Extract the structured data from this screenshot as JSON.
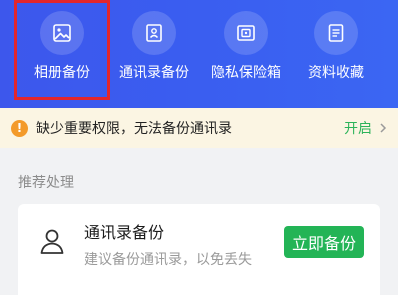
{
  "tools": {
    "items": [
      {
        "label": "相册备份",
        "icon": "photo-album-icon",
        "selected": true
      },
      {
        "label": "通讯录备份",
        "icon": "contacts-icon",
        "selected": false
      },
      {
        "label": "隐私保险箱",
        "icon": "safe-icon",
        "selected": false
      },
      {
        "label": "资料收藏",
        "icon": "document-icon",
        "selected": false
      }
    ]
  },
  "notice": {
    "text": "缺少重要权限，无法备份通讯录",
    "action": "开启",
    "icon": "warning-icon"
  },
  "recommend": {
    "section_title": "推荐处理",
    "card": {
      "title": "通讯录备份",
      "subtitle": "建议备份通讯录，以免丢失",
      "button": "立即备份",
      "icon": "person-icon"
    }
  },
  "colors": {
    "header_gradient_start": "#3d57ec",
    "header_gradient_end": "#3b66f3",
    "selection_border": "#e3262c",
    "notice_bg": "#fbf5e3",
    "warning_orange": "#f39a2a",
    "accent_green": "#23b456"
  }
}
